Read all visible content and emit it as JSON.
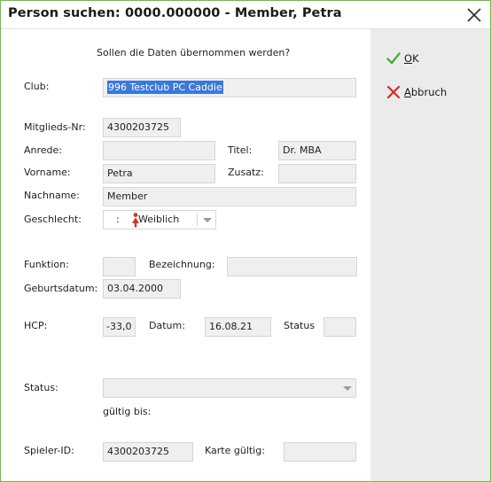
{
  "window": {
    "title": "Person suchen: 0000.000000 - Member, Petra"
  },
  "actions": {
    "ok_label": "OK",
    "cancel_label": "Abbruch"
  },
  "form": {
    "question": "Sollen die Daten übernommen werden?",
    "club": {
      "label": "Club:",
      "value": "996 Testclub PC Caddie"
    },
    "member_no": {
      "label": "Mitglieds-Nr:",
      "value": "4300203725"
    },
    "salutation": {
      "label": "Anrede:",
      "value": ""
    },
    "title_field": {
      "label": "Titel:",
      "value": "Dr. MBA"
    },
    "firstname": {
      "label": "Vorname:",
      "value": "Petra"
    },
    "suffix": {
      "label": "Zusatz:",
      "value": ""
    },
    "lastname": {
      "label": "Nachname:",
      "value": "Member"
    },
    "gender": {
      "label": "Geschlecht:",
      "prefix": ":",
      "value": "Weiblich"
    },
    "function": {
      "label": "Funktion:",
      "value": ""
    },
    "designation": {
      "label": "Bezeichnung:",
      "value": ""
    },
    "birthdate": {
      "label": "Geburtsdatum:",
      "value": "03.04.2000"
    },
    "hcp": {
      "label": "HCP:",
      "value": "-33,0"
    },
    "date": {
      "label": "Datum:",
      "value": "16.08.21"
    },
    "hcp_status": {
      "label": "Status",
      "value": ""
    },
    "status": {
      "label": "Status:",
      "value": "",
      "valid_until_label": "gültig bis:"
    },
    "player_id": {
      "label": "Spieler-ID:",
      "value": "4300203725"
    },
    "card_valid": {
      "label": "Karte gültig:",
      "value": ""
    }
  },
  "colors": {
    "border_accent": "#6abf3a",
    "ok_check": "#4caf33",
    "cancel_x": "#d9262a",
    "selection": "#3b78d8",
    "female_icon": "#c0392b"
  }
}
